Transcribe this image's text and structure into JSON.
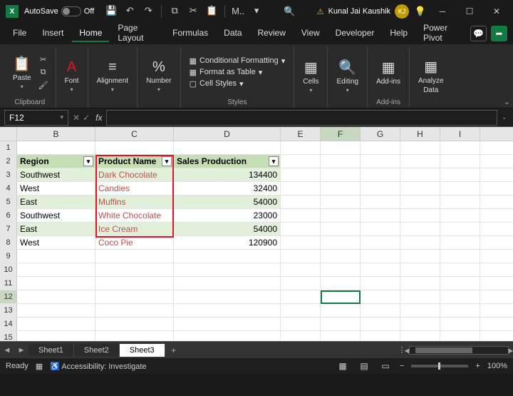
{
  "titlebar": {
    "autosave_label": "AutoSave",
    "autosave_state": "Off",
    "doc_initial": "M..",
    "user_name": "Kunal Jai Kaushik",
    "user_initials": "KJ"
  },
  "tabs": [
    "File",
    "Insert",
    "Home",
    "Page Layout",
    "Formulas",
    "Data",
    "Review",
    "View",
    "Developer",
    "Help",
    "Power Pivot"
  ],
  "active_tab": "Home",
  "ribbon": {
    "clipboard": {
      "paste": "Paste",
      "label": "Clipboard"
    },
    "font": {
      "btn": "Font",
      "drop": "▾"
    },
    "alignment": {
      "btn": "Alignment"
    },
    "number": {
      "btn": "Number"
    },
    "styles": {
      "cond": "Conditional Formatting",
      "fat": "Format as Table",
      "cs": "Cell Styles",
      "label": "Styles"
    },
    "cells": {
      "btn": "Cells"
    },
    "editing": {
      "btn": "Editing"
    },
    "addins": {
      "btn": "Add-ins",
      "label": "Add-ins"
    },
    "analyze": {
      "btn": "Analyze",
      "btn2": "Data"
    }
  },
  "namebox": "F12",
  "headers": {
    "B": "Region",
    "C": "Product Name",
    "D": "Sales Production"
  },
  "data_rows": [
    {
      "r": 3,
      "region": "Southwest",
      "product": "Dark Chocolate",
      "sales": "134400",
      "band": true
    },
    {
      "r": 4,
      "region": "West",
      "product": "Candies",
      "sales": "32400",
      "band": false
    },
    {
      "r": 5,
      "region": "East",
      "product": "Muffins",
      "sales": "54000",
      "band": true
    },
    {
      "r": 6,
      "region": "Southwest",
      "product": "White Chocolate",
      "sales": "23000",
      "band": false
    },
    {
      "r": 7,
      "region": "East",
      "product": "Ice Cream",
      "sales": "54000",
      "band": true
    },
    {
      "r": 8,
      "region": "West",
      "product": "Coco Pie",
      "sales": "120900",
      "band": false
    }
  ],
  "sheets": [
    "Sheet1",
    "Sheet2",
    "Sheet3"
  ],
  "active_sheet": "Sheet3",
  "status": {
    "ready": "Ready",
    "acc": "Accessibility: Investigate",
    "zoom": "100%"
  }
}
